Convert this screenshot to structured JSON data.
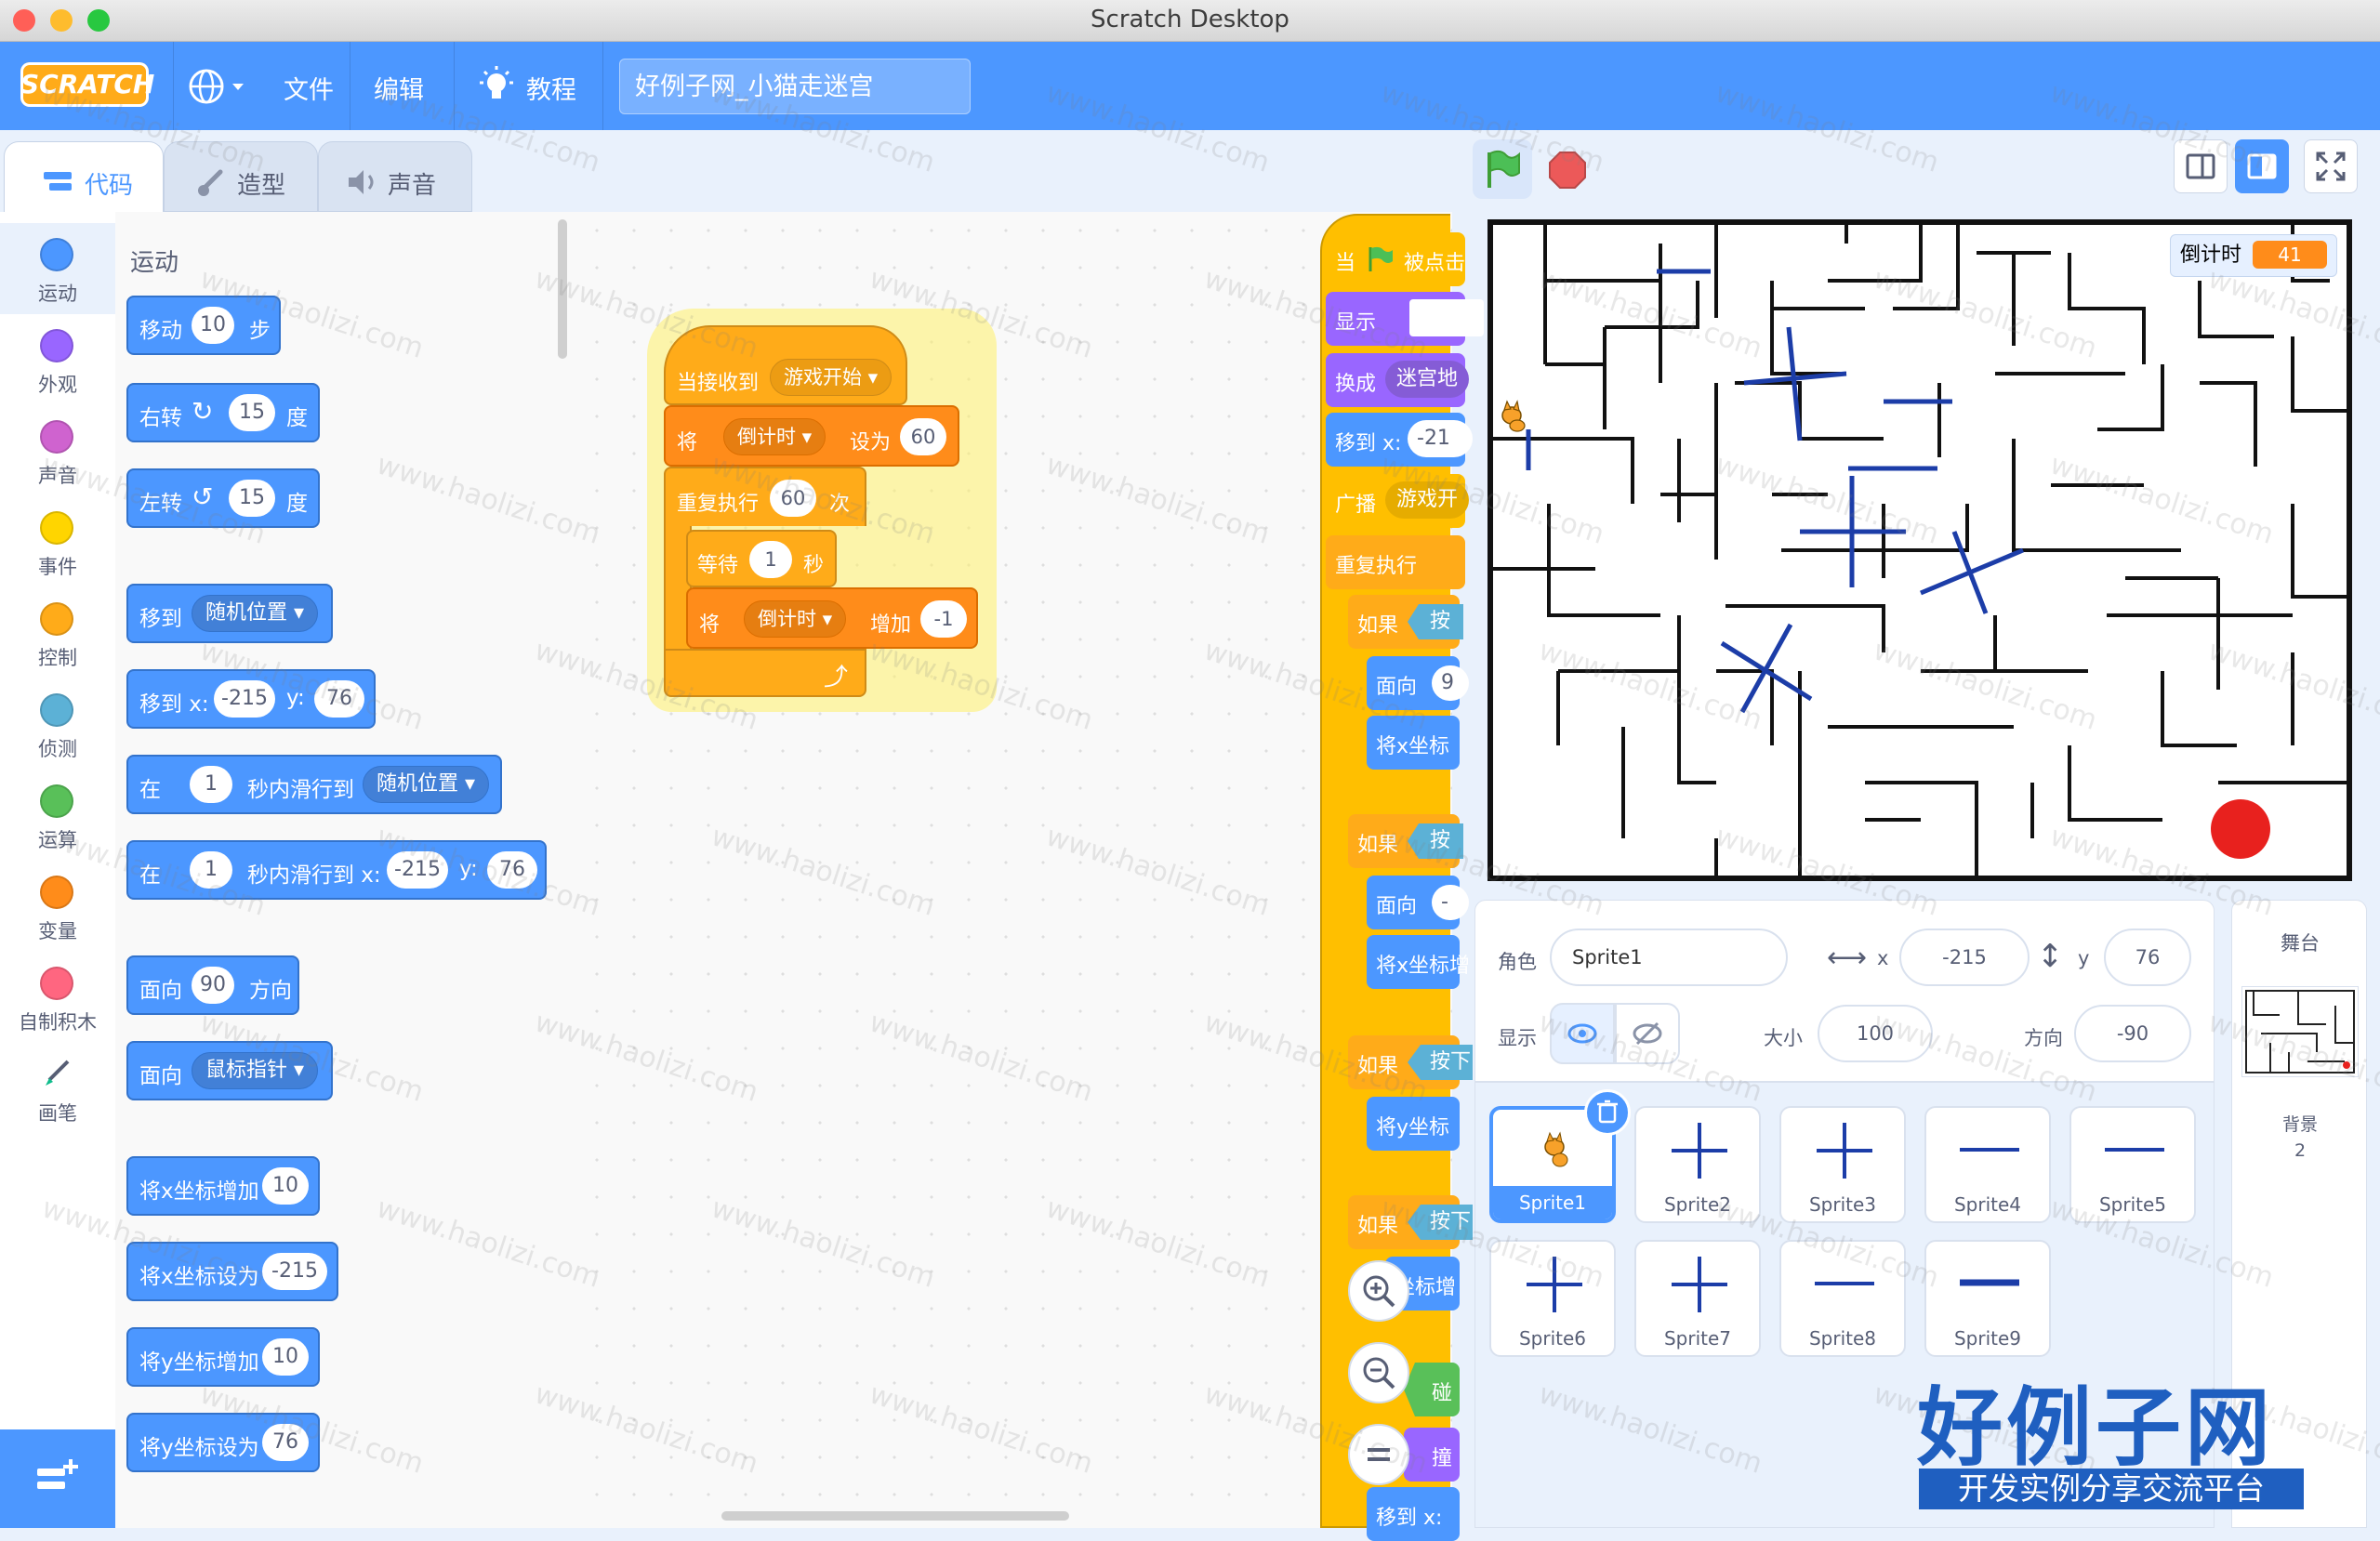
{
  "window": {
    "title": "Scratch Desktop"
  },
  "menubar": {
    "logo": "SCRATCH",
    "file": "文件",
    "edit": "编辑",
    "tutorials": "教程",
    "project_name": "好例子网_小猫走迷宫"
  },
  "tabs": {
    "code": "代码",
    "costumes": "造型",
    "sounds": "声音"
  },
  "categories": [
    {
      "label": "运动",
      "color": "#4c97ff"
    },
    {
      "label": "外观",
      "color": "#9966ff"
    },
    {
      "label": "声音",
      "color": "#cf63cf"
    },
    {
      "label": "事件",
      "color": "#ffd500"
    },
    {
      "label": "控制",
      "color": "#ffab19"
    },
    {
      "label": "侦测",
      "color": "#5cb1d6"
    },
    {
      "label": "运算",
      "color": "#59c059"
    },
    {
      "label": "变量",
      "color": "#ff8c1a"
    },
    {
      "label": "自制积木",
      "color": "#ff6680"
    },
    {
      "label": "画笔",
      "color": "#0fbd8c"
    }
  ],
  "palette": {
    "title": "运动",
    "move": {
      "a": "移动",
      "v": "10",
      "b": "步"
    },
    "turn_right": {
      "a": "右转",
      "v": "15",
      "b": "度"
    },
    "turn_left": {
      "a": "左转",
      "v": "15",
      "b": "度"
    },
    "goto": {
      "a": "移到",
      "dd": "随机位置"
    },
    "goto_xy": {
      "a": "移到 x:",
      "x": "-215",
      "b": "y:",
      "y": "76"
    },
    "glide": {
      "a": "在",
      "v": "1",
      "b": "秒内滑行到",
      "dd": "随机位置"
    },
    "glide_xy": {
      "a": "在",
      "v": "1",
      "b": "秒内滑行到 x:",
      "x": "-215",
      "c": "y:",
      "y": "76"
    },
    "point_dir": {
      "a": "面向",
      "v": "90",
      "b": "方向"
    },
    "point_towards": {
      "a": "面向",
      "dd": "鼠标指针"
    },
    "change_x": {
      "a": "将x坐标增加",
      "v": "10"
    },
    "set_x": {
      "a": "将x坐标设为",
      "v": "-215"
    },
    "change_y": {
      "a": "将y坐标增加",
      "v": "10"
    },
    "set_y": {
      "a": "将y坐标设为",
      "v": "76"
    }
  },
  "script": {
    "hat": {
      "a": "当接收到",
      "dd": "游戏开始"
    },
    "set_var": {
      "a": "将",
      "dd": "倒计时",
      "b": "设为",
      "v": "60"
    },
    "repeat": {
      "a": "重复执行",
      "v": "60",
      "b": "次"
    },
    "wait": {
      "a": "等待",
      "v": "1",
      "b": "秒"
    },
    "change_var": {
      "a": "将",
      "dd": "倒计时",
      "b": "增加",
      "v": "-1"
    }
  },
  "script2": {
    "l1": "当",
    "l1b": "被点击",
    "l2": "显示",
    "l3": "换成",
    "l3dd": "迷宫地",
    "l4": "移到 x:",
    "l4v": "-21",
    "l5": "广播",
    "l5dd": "游戏开",
    "l6": "重复执行",
    "if1": "如果",
    "if1s": "按",
    "face1": "面向",
    "face1v": "9",
    "setx1": "将x坐标",
    "if2": "如果",
    "if2s": "按",
    "face2": "面向",
    "face2v": "-",
    "setx2": "将x坐标增",
    "if3": "如果",
    "if3s": "按下",
    "sety3": "将y坐标",
    "if4": "如果",
    "if4s": "按下",
    "sety4": "坐标增",
    "touch": "碰",
    "touch2": "撞",
    "moveto": "移到 x:"
  },
  "stage_monitor": {
    "label": "倒计时",
    "value": "41"
  },
  "sprite_info": {
    "sprite_label": "角色",
    "sprite_name": "Sprite1",
    "x_label": "x",
    "x": "-215",
    "y_label": "y",
    "y": "76",
    "show_label": "显示",
    "size_label": "大小",
    "size": "100",
    "dir_label": "方向",
    "direction": "-90"
  },
  "sprites": [
    "Sprite1",
    "Sprite2",
    "Sprite3",
    "Sprite4",
    "Sprite5",
    "Sprite6",
    "Sprite7",
    "Sprite8",
    "Sprite9"
  ],
  "stage_panel": {
    "title": "舞台",
    "backdrops_label": "背景",
    "backdrops_count": "2"
  },
  "watermark": {
    "main": "好例子网",
    "sub": "开发实例分享交流平台",
    "tile": "www.haolizi.com"
  }
}
